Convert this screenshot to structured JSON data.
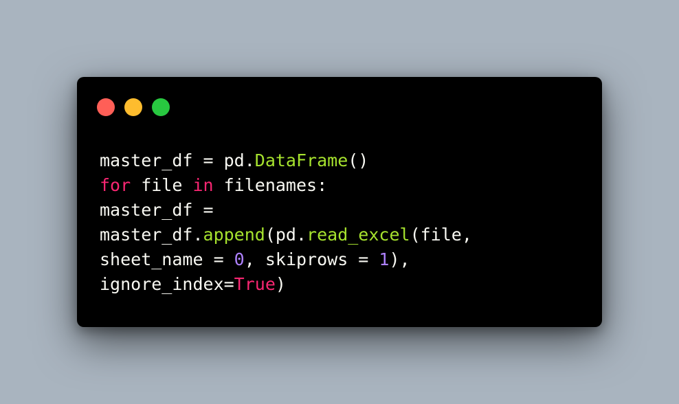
{
  "window": {
    "buttons": [
      {
        "name": "close-button",
        "color": "#ff5f57",
        "icon": "close-dot"
      },
      {
        "name": "minimize-button",
        "color": "#febc2e",
        "icon": "minimize-dot"
      },
      {
        "name": "maximize-button",
        "color": "#28c840",
        "icon": "maximize-dot"
      }
    ]
  },
  "colors": {
    "background": "#a9b4bf",
    "editor_background": "#000000",
    "text": "#f8f8f2",
    "keyword": "#f92672",
    "function": "#a6e22e",
    "number": "#ae81ff"
  },
  "code": {
    "lines": [
      [
        {
          "t": "master_df = pd.",
          "c": "plain"
        },
        {
          "t": "DataFrame",
          "c": "fn"
        },
        {
          "t": "()",
          "c": "plain"
        }
      ],
      [
        {
          "t": "for",
          "c": "kw"
        },
        {
          "t": " file ",
          "c": "plain"
        },
        {
          "t": "in",
          "c": "kw"
        },
        {
          "t": " filenames:",
          "c": "plain"
        }
      ],
      [
        {
          "t": "master_df =",
          "c": "plain"
        }
      ],
      [
        {
          "t": "master_df.",
          "c": "plain"
        },
        {
          "t": "append",
          "c": "fn"
        },
        {
          "t": "(pd.",
          "c": "plain"
        },
        {
          "t": "read_excel",
          "c": "fn"
        },
        {
          "t": "(file,",
          "c": "plain"
        }
      ],
      [
        {
          "t": "sheet_name = ",
          "c": "plain"
        },
        {
          "t": "0",
          "c": "num"
        },
        {
          "t": ", skiprows = ",
          "c": "plain"
        },
        {
          "t": "1",
          "c": "num"
        },
        {
          "t": "),",
          "c": "plain"
        }
      ],
      [
        {
          "t": "ignore_index=",
          "c": "plain"
        },
        {
          "t": "True",
          "c": "kw"
        },
        {
          "t": ")",
          "c": "plain"
        }
      ]
    ]
  }
}
